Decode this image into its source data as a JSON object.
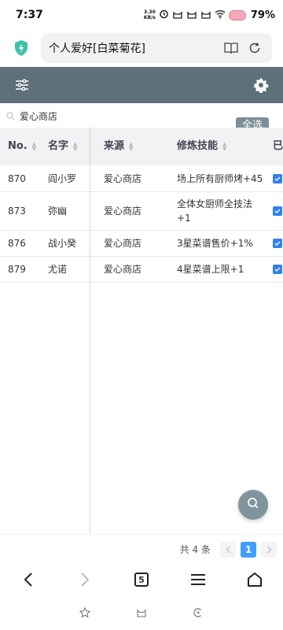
{
  "status": {
    "time": "7:37",
    "net_speed_value": "3.30",
    "net_speed_unit": "KB/s",
    "battery": "79%"
  },
  "address": {
    "title": "个人爱好[白菜菊花]"
  },
  "filter": {
    "text": "爱心商店"
  },
  "select_all_label": "全选",
  "table": {
    "headers": {
      "no": "No.",
      "name": "名字",
      "source": "来源",
      "skill": "修炼技能",
      "owned": "已"
    },
    "rows": [
      {
        "no": "870",
        "name": "阎小罗",
        "source": "爱心商店",
        "skill": "场上所有厨师烤+45",
        "checked": true
      },
      {
        "no": "873",
        "name": "弥幽",
        "source": "爱心商店",
        "skill": "全体女厨师全技法+1",
        "checked": true
      },
      {
        "no": "876",
        "name": "战小癸",
        "source": "爱心商店",
        "skill": "3星菜谱售价+1%",
        "checked": true
      },
      {
        "no": "879",
        "name": "尤诺",
        "source": "爱心商店",
        "skill": "4星菜谱上限+1",
        "checked": true
      }
    ]
  },
  "pager": {
    "total": "共 4 条",
    "current_page": "1"
  },
  "browser": {
    "tab_count": "5"
  },
  "colors": {
    "toolbar": "#5e7079",
    "accent_blue": "#409eff",
    "checkbox": "#2f80ed",
    "fab": "#7f949d",
    "shield": "#3fc1a8"
  }
}
